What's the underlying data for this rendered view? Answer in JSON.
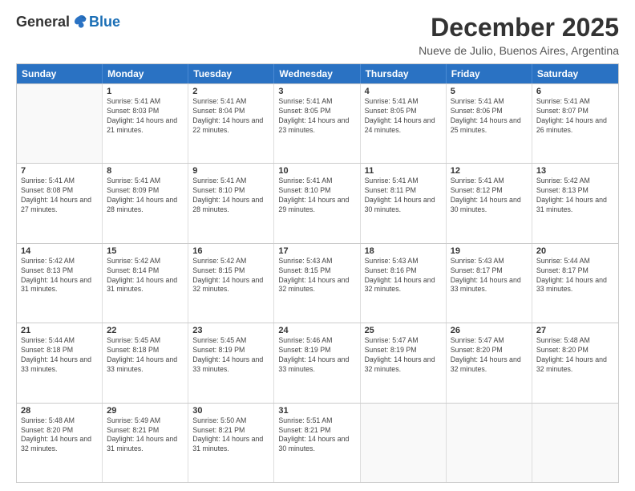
{
  "header": {
    "logo_general": "General",
    "logo_blue": "Blue",
    "month_title": "December 2025",
    "subtitle": "Nueve de Julio, Buenos Aires, Argentina"
  },
  "weekdays": [
    "Sunday",
    "Monday",
    "Tuesday",
    "Wednesday",
    "Thursday",
    "Friday",
    "Saturday"
  ],
  "weeks": [
    [
      {
        "day": "",
        "sunrise": "",
        "sunset": "",
        "daylight": ""
      },
      {
        "day": "1",
        "sunrise": "Sunrise: 5:41 AM",
        "sunset": "Sunset: 8:03 PM",
        "daylight": "Daylight: 14 hours and 21 minutes."
      },
      {
        "day": "2",
        "sunrise": "Sunrise: 5:41 AM",
        "sunset": "Sunset: 8:04 PM",
        "daylight": "Daylight: 14 hours and 22 minutes."
      },
      {
        "day": "3",
        "sunrise": "Sunrise: 5:41 AM",
        "sunset": "Sunset: 8:05 PM",
        "daylight": "Daylight: 14 hours and 23 minutes."
      },
      {
        "day": "4",
        "sunrise": "Sunrise: 5:41 AM",
        "sunset": "Sunset: 8:05 PM",
        "daylight": "Daylight: 14 hours and 24 minutes."
      },
      {
        "day": "5",
        "sunrise": "Sunrise: 5:41 AM",
        "sunset": "Sunset: 8:06 PM",
        "daylight": "Daylight: 14 hours and 25 minutes."
      },
      {
        "day": "6",
        "sunrise": "Sunrise: 5:41 AM",
        "sunset": "Sunset: 8:07 PM",
        "daylight": "Daylight: 14 hours and 26 minutes."
      }
    ],
    [
      {
        "day": "7",
        "sunrise": "Sunrise: 5:41 AM",
        "sunset": "Sunset: 8:08 PM",
        "daylight": "Daylight: 14 hours and 27 minutes."
      },
      {
        "day": "8",
        "sunrise": "Sunrise: 5:41 AM",
        "sunset": "Sunset: 8:09 PM",
        "daylight": "Daylight: 14 hours and 28 minutes."
      },
      {
        "day": "9",
        "sunrise": "Sunrise: 5:41 AM",
        "sunset": "Sunset: 8:10 PM",
        "daylight": "Daylight: 14 hours and 28 minutes."
      },
      {
        "day": "10",
        "sunrise": "Sunrise: 5:41 AM",
        "sunset": "Sunset: 8:10 PM",
        "daylight": "Daylight: 14 hours and 29 minutes."
      },
      {
        "day": "11",
        "sunrise": "Sunrise: 5:41 AM",
        "sunset": "Sunset: 8:11 PM",
        "daylight": "Daylight: 14 hours and 30 minutes."
      },
      {
        "day": "12",
        "sunrise": "Sunrise: 5:41 AM",
        "sunset": "Sunset: 8:12 PM",
        "daylight": "Daylight: 14 hours and 30 minutes."
      },
      {
        "day": "13",
        "sunrise": "Sunrise: 5:42 AM",
        "sunset": "Sunset: 8:13 PM",
        "daylight": "Daylight: 14 hours and 31 minutes."
      }
    ],
    [
      {
        "day": "14",
        "sunrise": "Sunrise: 5:42 AM",
        "sunset": "Sunset: 8:13 PM",
        "daylight": "Daylight: 14 hours and 31 minutes."
      },
      {
        "day": "15",
        "sunrise": "Sunrise: 5:42 AM",
        "sunset": "Sunset: 8:14 PM",
        "daylight": "Daylight: 14 hours and 31 minutes."
      },
      {
        "day": "16",
        "sunrise": "Sunrise: 5:42 AM",
        "sunset": "Sunset: 8:15 PM",
        "daylight": "Daylight: 14 hours and 32 minutes."
      },
      {
        "day": "17",
        "sunrise": "Sunrise: 5:43 AM",
        "sunset": "Sunset: 8:15 PM",
        "daylight": "Daylight: 14 hours and 32 minutes."
      },
      {
        "day": "18",
        "sunrise": "Sunrise: 5:43 AM",
        "sunset": "Sunset: 8:16 PM",
        "daylight": "Daylight: 14 hours and 32 minutes."
      },
      {
        "day": "19",
        "sunrise": "Sunrise: 5:43 AM",
        "sunset": "Sunset: 8:17 PM",
        "daylight": "Daylight: 14 hours and 33 minutes."
      },
      {
        "day": "20",
        "sunrise": "Sunrise: 5:44 AM",
        "sunset": "Sunset: 8:17 PM",
        "daylight": "Daylight: 14 hours and 33 minutes."
      }
    ],
    [
      {
        "day": "21",
        "sunrise": "Sunrise: 5:44 AM",
        "sunset": "Sunset: 8:18 PM",
        "daylight": "Daylight: 14 hours and 33 minutes."
      },
      {
        "day": "22",
        "sunrise": "Sunrise: 5:45 AM",
        "sunset": "Sunset: 8:18 PM",
        "daylight": "Daylight: 14 hours and 33 minutes."
      },
      {
        "day": "23",
        "sunrise": "Sunrise: 5:45 AM",
        "sunset": "Sunset: 8:19 PM",
        "daylight": "Daylight: 14 hours and 33 minutes."
      },
      {
        "day": "24",
        "sunrise": "Sunrise: 5:46 AM",
        "sunset": "Sunset: 8:19 PM",
        "daylight": "Daylight: 14 hours and 33 minutes."
      },
      {
        "day": "25",
        "sunrise": "Sunrise: 5:47 AM",
        "sunset": "Sunset: 8:19 PM",
        "daylight": "Daylight: 14 hours and 32 minutes."
      },
      {
        "day": "26",
        "sunrise": "Sunrise: 5:47 AM",
        "sunset": "Sunset: 8:20 PM",
        "daylight": "Daylight: 14 hours and 32 minutes."
      },
      {
        "day": "27",
        "sunrise": "Sunrise: 5:48 AM",
        "sunset": "Sunset: 8:20 PM",
        "daylight": "Daylight: 14 hours and 32 minutes."
      }
    ],
    [
      {
        "day": "28",
        "sunrise": "Sunrise: 5:48 AM",
        "sunset": "Sunset: 8:20 PM",
        "daylight": "Daylight: 14 hours and 32 minutes."
      },
      {
        "day": "29",
        "sunrise": "Sunrise: 5:49 AM",
        "sunset": "Sunset: 8:21 PM",
        "daylight": "Daylight: 14 hours and 31 minutes."
      },
      {
        "day": "30",
        "sunrise": "Sunrise: 5:50 AM",
        "sunset": "Sunset: 8:21 PM",
        "daylight": "Daylight: 14 hours and 31 minutes."
      },
      {
        "day": "31",
        "sunrise": "Sunrise: 5:51 AM",
        "sunset": "Sunset: 8:21 PM",
        "daylight": "Daylight: 14 hours and 30 minutes."
      },
      {
        "day": "",
        "sunrise": "",
        "sunset": "",
        "daylight": ""
      },
      {
        "day": "",
        "sunrise": "",
        "sunset": "",
        "daylight": ""
      },
      {
        "day": "",
        "sunrise": "",
        "sunset": "",
        "daylight": ""
      }
    ]
  ]
}
